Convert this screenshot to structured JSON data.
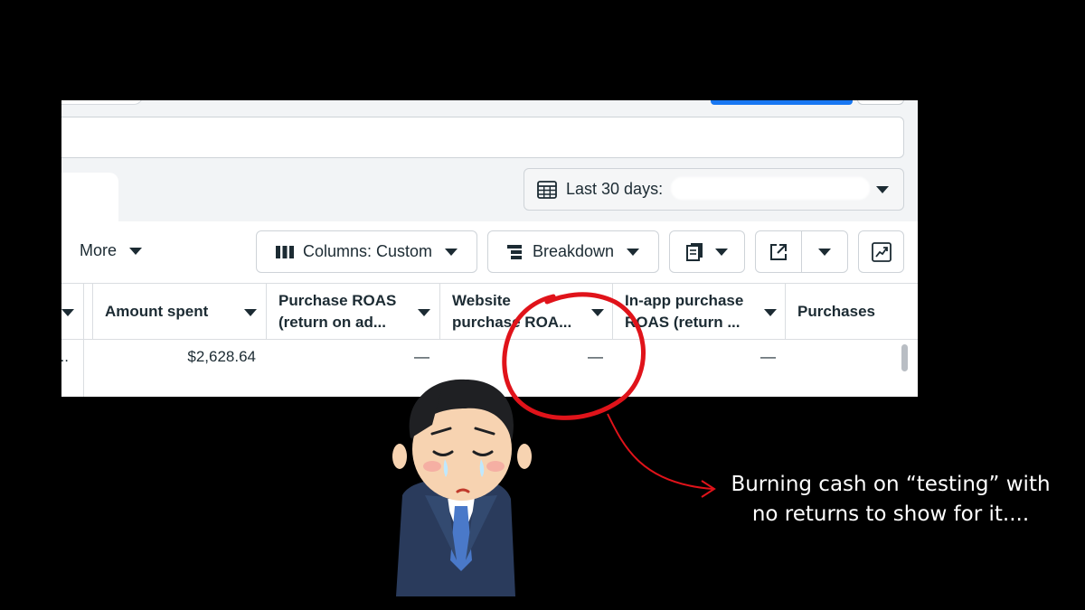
{
  "toolbar": {
    "date_range_label": "Last 30 days:",
    "more_label": "More",
    "columns_label": "Columns: Custom",
    "breakdown_label": "Breakdown"
  },
  "table": {
    "headers": [
      "Amount spent",
      "Purchase ROAS (return on ad...",
      "Website purchase ROA...",
      "In-app purchase ROAS (return ...",
      "Purchases"
    ],
    "first_row": {
      "truncated_cell": "..",
      "amount_spent": "$2,628.64",
      "purchase_roas": "—",
      "website_purchase_roas": "—",
      "in_app_purchase_roas": "—",
      "purchases": ""
    }
  },
  "annotation": {
    "caption_line1": "Burning cash on “testing” with",
    "caption_line2": "no returns to show for it....",
    "circle_color": "#e0131a",
    "arrow_color": "#e0131a"
  },
  "colors": {
    "primary_button": "#1877f2",
    "background": "#000000"
  },
  "icons": [
    "calendar-icon",
    "columns-icon",
    "breakdown-icon",
    "report-icon",
    "export-icon",
    "chart-icon",
    "dropdown-caret-icon"
  ]
}
